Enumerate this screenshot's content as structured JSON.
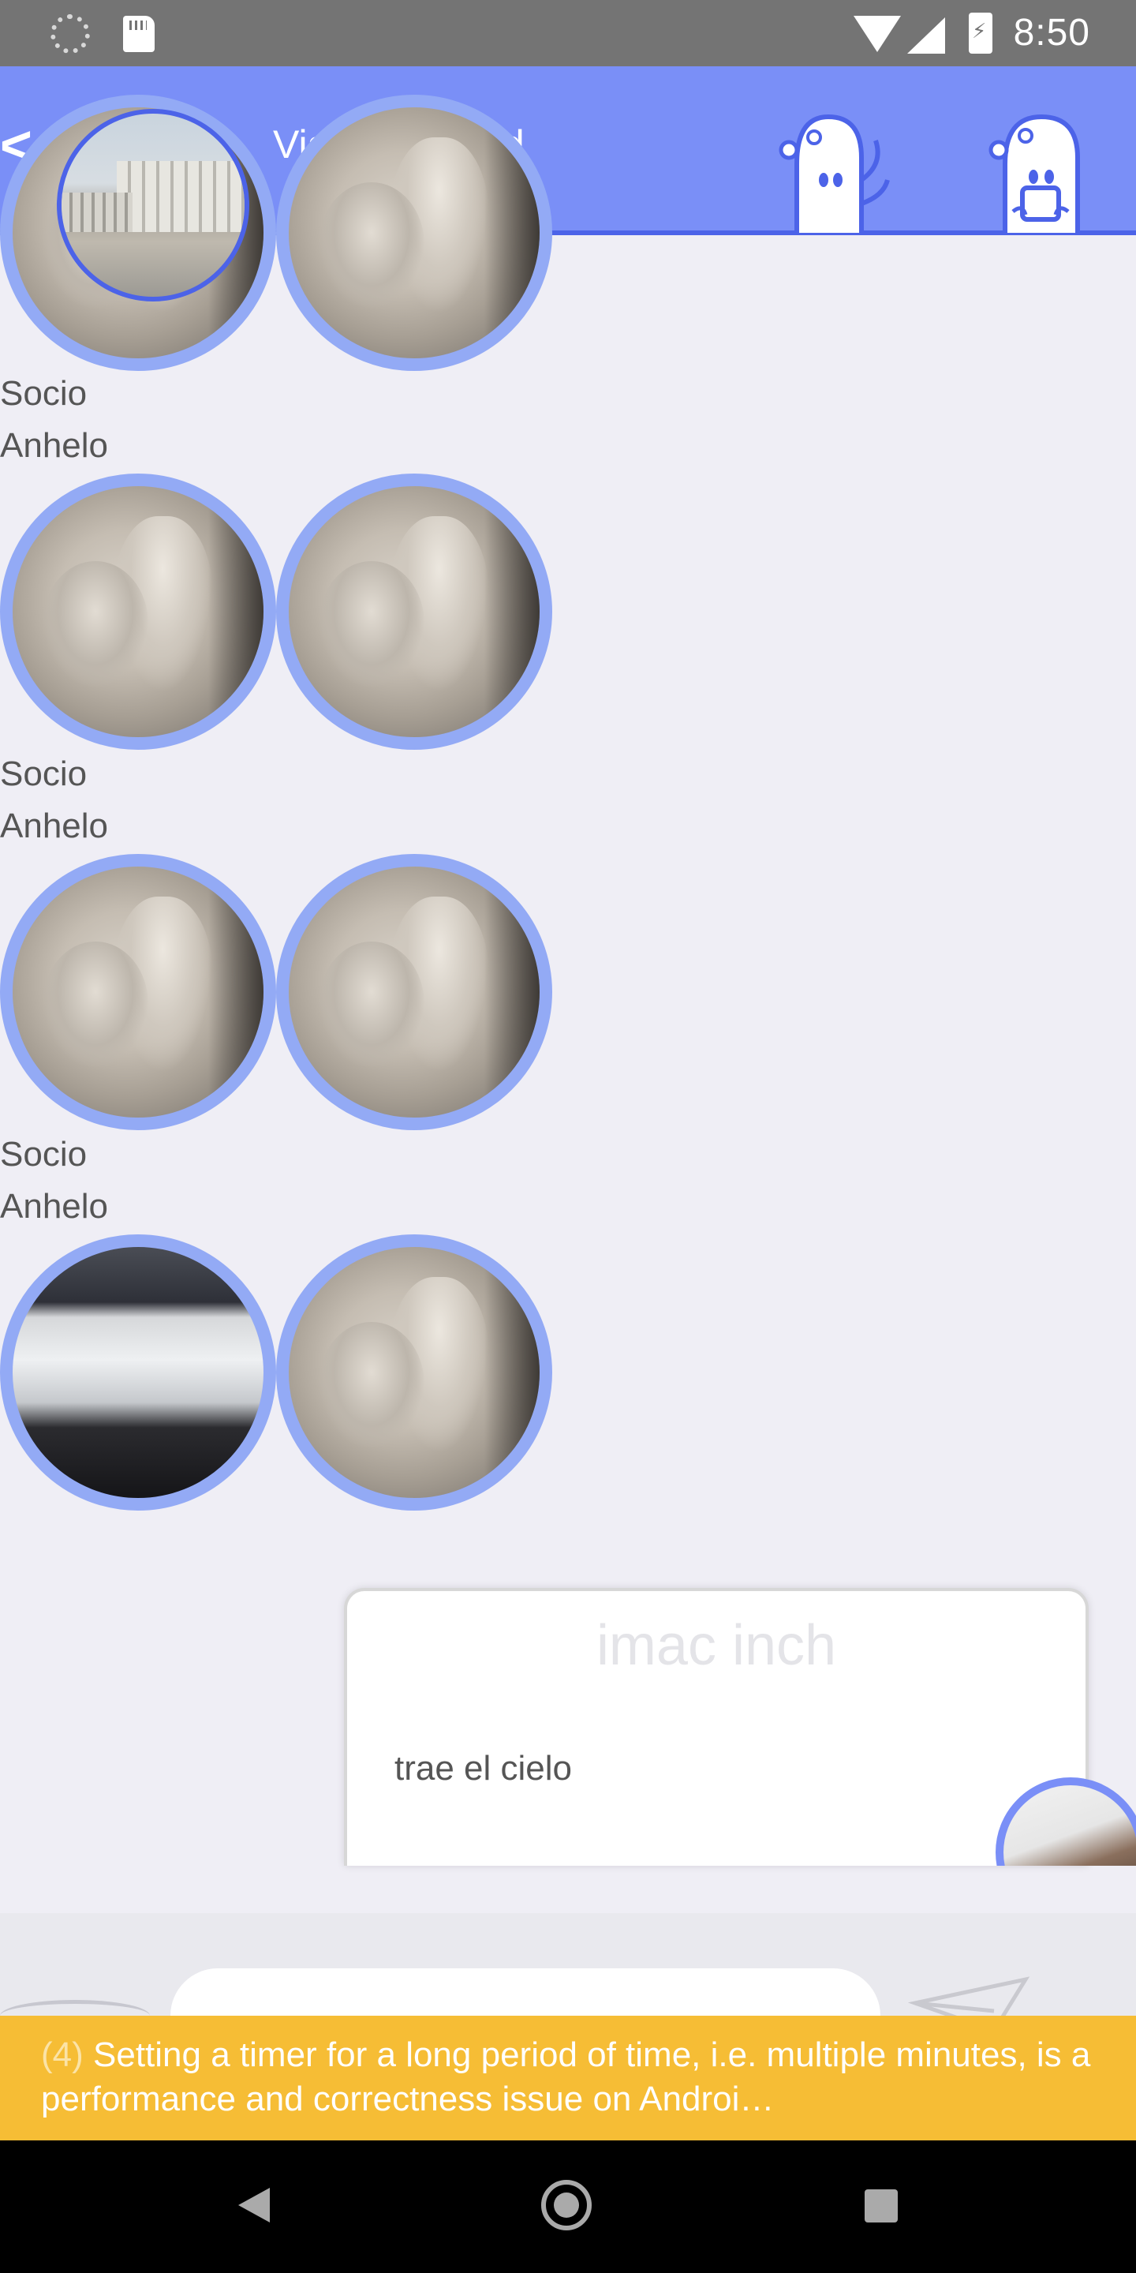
{
  "status_bar": {
    "time": "8:50",
    "icons": [
      "loading-icon",
      "sd-card-icon",
      "wifi-icon",
      "cell-signal-icon",
      "battery-charging-icon"
    ]
  },
  "header": {
    "back_label": "<",
    "title": "Viaje a madrid",
    "actions": [
      "ghost-wave-icon",
      "ghost-phone-icon"
    ],
    "colors": {
      "bar": "#7a8ff7",
      "border": "#4c63e8"
    }
  },
  "feed": {
    "groups": [
      {
        "labels": [],
        "photos": [
          "relief-sculpture",
          "relief-sculpture"
        ]
      },
      {
        "labels": [
          "Socio",
          "Anhelo"
        ],
        "photos": [
          "relief-sculpture",
          "relief-sculpture"
        ]
      },
      {
        "labels": [
          "Socio",
          "Anhelo"
        ],
        "photos": [
          "relief-sculpture",
          "relief-sculpture"
        ]
      },
      {
        "labels": [
          "Socio",
          "Anhelo"
        ],
        "photos": [
          "laptop",
          "relief-sculpture"
        ]
      }
    ]
  },
  "card": {
    "title": "imac inch",
    "body": "trae el cielo"
  },
  "toast": {
    "count": "(4)",
    "message": "Setting a timer for a long period of time, i.e. multiple minutes, is a performance and correctness issue on Androi…",
    "color": "#f6bd35"
  },
  "nav_bar": {
    "buttons": [
      "nav-back-icon",
      "nav-home-icon",
      "nav-recents-icon"
    ]
  }
}
